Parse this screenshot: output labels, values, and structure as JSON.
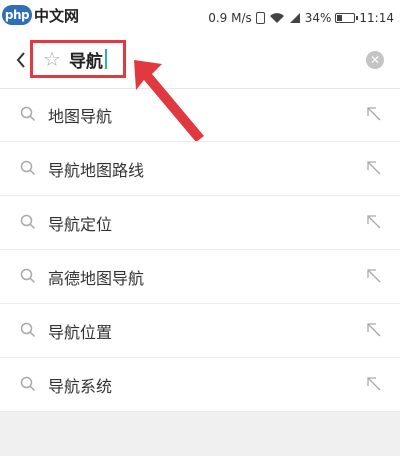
{
  "watermark": {
    "logo_text": "php",
    "site_text": "中文网"
  },
  "status_bar": {
    "speed": "0.9 M/s",
    "battery_percent": "34%",
    "battery_level": 0.34,
    "time": "11:14"
  },
  "search": {
    "query": "导航",
    "star_glyph": "☆",
    "clear_glyph": "✕"
  },
  "suggestions": [
    {
      "label": "地图导航"
    },
    {
      "label": "导航地图路线"
    },
    {
      "label": "导航定位"
    },
    {
      "label": "高德地图导航"
    },
    {
      "label": "导航位置"
    },
    {
      "label": "导航系统"
    }
  ],
  "colors": {
    "highlight_red": "#e0393f",
    "caret_teal": "#2fb4a3"
  },
  "icons": {
    "back": "back-icon",
    "clear": "clear-icon",
    "suggest": "search-icon",
    "fill": "arrow-up-left-icon"
  }
}
